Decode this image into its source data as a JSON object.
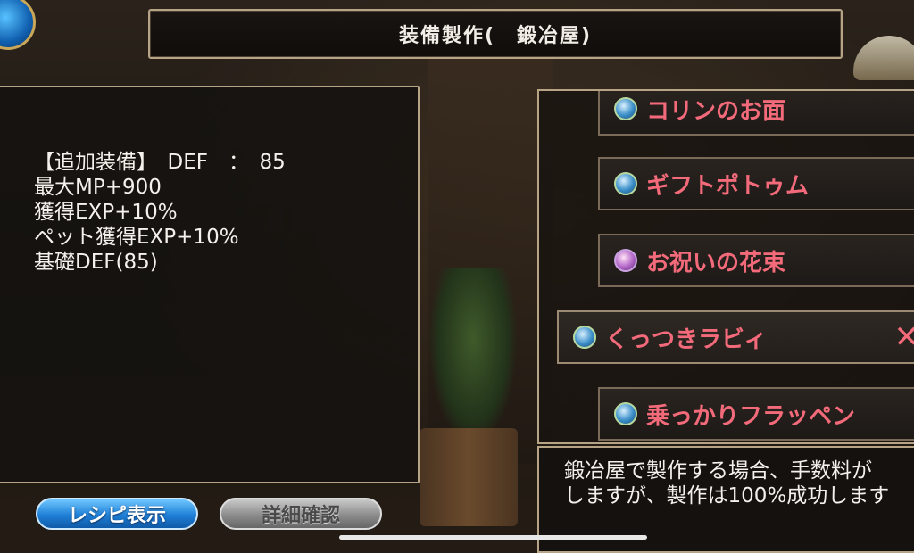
{
  "title": "装備製作(　鍛冶屋)",
  "stats": [
    "【追加装備】　DEF　：　85",
    "最大MP+900",
    "獲得EXP+10%",
    "ペット獲得EXP+10%",
    "基礎DEF(85)"
  ],
  "items": [
    {
      "label": "コリンのお面",
      "icon": "hat-icon"
    },
    {
      "label": "ギフトポトゥム",
      "icon": "hat-icon"
    },
    {
      "label": "お祝いの花束",
      "icon": "wand-icon"
    },
    {
      "label": "くっつきラビィ",
      "icon": "hat-icon",
      "selected": true
    },
    {
      "label": "乗っかりフラッペン",
      "icon": "hat-icon"
    }
  ],
  "close_symbol": "✕",
  "description": [
    "鍛冶屋で製作する場合、手数料が",
    "しますが、製作は100%成功します"
  ],
  "buttons": {
    "recipe": "レシピ表示",
    "detail": "詳細確認"
  },
  "colors": {
    "accent_text": "#f36a7a",
    "frame_gold": "#b7a487",
    "recipe_button": "#1f7fd6",
    "detail_button": "#8c8c8c"
  }
}
